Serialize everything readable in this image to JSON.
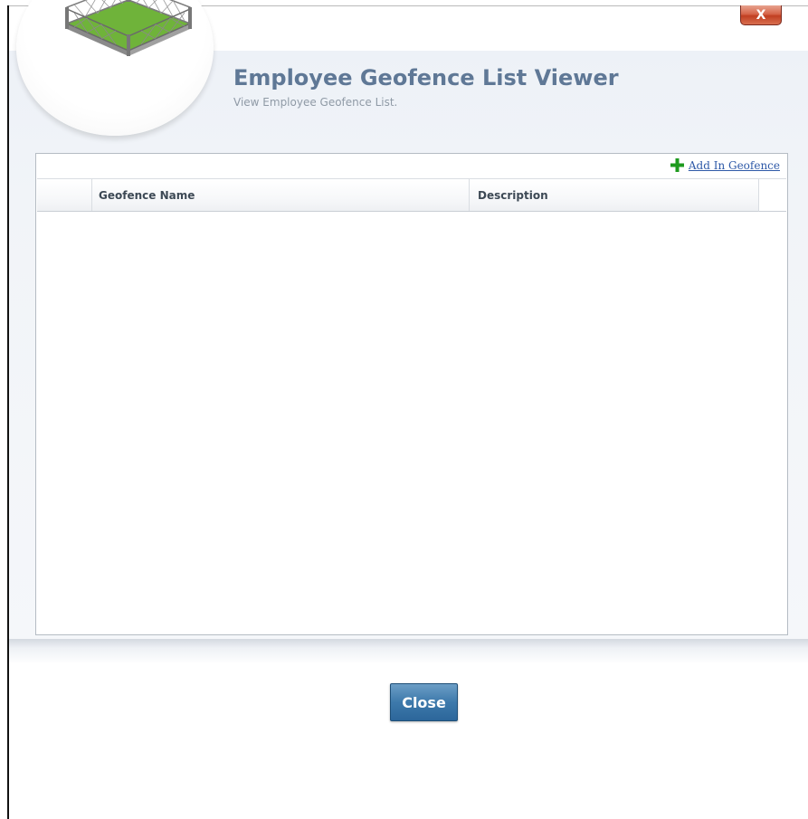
{
  "window": {
    "close_glyph": "X"
  },
  "header": {
    "title": "Employee Geofence List Viewer",
    "subtitle": "View Employee Geofence List.",
    "logo_icon": "geofence-fence-icon"
  },
  "toolbar": {
    "add_icon": "plus-icon",
    "add_label": "Add In Geofence"
  },
  "grid": {
    "columns": [
      "",
      "Geofence Name",
      "Description"
    ],
    "rows": []
  },
  "footer": {
    "close_label": "Close"
  },
  "colors": {
    "title": "#5f7896",
    "link": "#2f5aa8",
    "button": "#3d79ab",
    "close_x": "#c13f22",
    "add_icon": "#1e9a1e"
  }
}
